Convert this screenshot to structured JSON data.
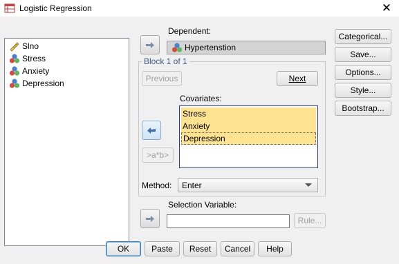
{
  "window": {
    "title": "Logistic Regression",
    "close_glyph": "✕"
  },
  "variables": [
    {
      "name": "Slno",
      "icon": "scale-ruler-icon"
    },
    {
      "name": "Stress",
      "icon": "nominal-balls-icon"
    },
    {
      "name": "Anxiety",
      "icon": "nominal-balls-icon"
    },
    {
      "name": "Depression",
      "icon": "nominal-balls-icon"
    }
  ],
  "dependent": {
    "label": "Dependent:",
    "value": "Hypertenstion"
  },
  "block": {
    "legend": "Block 1 of 1",
    "previous_label": "Previous",
    "next_label": "Next"
  },
  "covariates": {
    "label": "Covariates:",
    "items": [
      "Stress",
      "Anxiety",
      "Depression"
    ],
    "interaction_label": ">a*b>"
  },
  "method": {
    "label": "Method:",
    "value": "Enter"
  },
  "selection": {
    "label": "Selection Variable:",
    "rule_label": "Rule..."
  },
  "side_buttons": [
    "Categorical...",
    "Save...",
    "Options...",
    "Style...",
    "Bootstrap..."
  ],
  "bottom_buttons": [
    "OK",
    "Paste",
    "Reset",
    "Cancel",
    "Help"
  ],
  "colors": {
    "highlight": "#fde28f",
    "default_border": "#3c7fb1",
    "legend_text": "#3b5b8a"
  }
}
